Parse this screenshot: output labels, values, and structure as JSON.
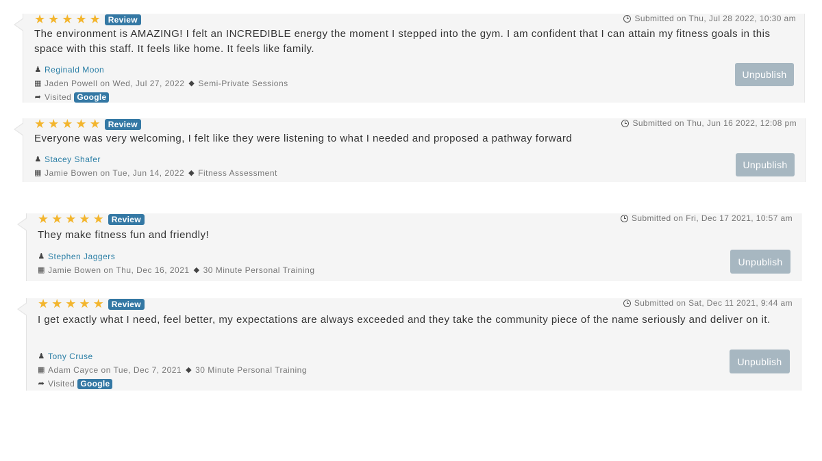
{
  "reviews": [
    {
      "stars": [
        "★",
        "★",
        "★",
        "★",
        "★"
      ],
      "badge": "Review",
      "submitted": "Submitted on Thu, Jul 28 2022, 10:30 am",
      "text": "The environment is AMAZING! I felt an INCREDIBLE energy the moment I stepped into the gym. I am confident that I can attain my fitness goals in this space with this staff. It feels like home. It feels like family.",
      "author": "Reginald Moon",
      "booking": "Jaden Powell on Wed, Jul 27, 2022",
      "service": "Semi-Private Sessions",
      "visited_label": "Visited",
      "visited_source": "Google",
      "button": "Unpublish"
    },
    {
      "stars": [
        "★",
        "★",
        "★",
        "★",
        "★"
      ],
      "badge": "Review",
      "submitted": "Submitted on Thu, Jun 16 2022, 12:08 pm",
      "text": "Everyone was very welcoming, I felt like they were listening to what I needed and proposed a pathway forward",
      "author": "Stacey Shafer",
      "booking": "Jamie Bowen on Tue, Jun 14, 2022",
      "service": "Fitness Assessment",
      "button": "Unpublish"
    },
    {
      "stars": [
        "★",
        "★",
        "★",
        "★",
        "★"
      ],
      "badge": "Review",
      "submitted": "Submitted on Fri, Dec 17 2021, 10:57 am",
      "text": "They make fitness fun and friendly!",
      "author": "Stephen Jaggers",
      "booking": "Jamie Bowen on Thu, Dec 16, 2021",
      "service": "30 Minute Personal Training",
      "button": "Unpublish"
    },
    {
      "stars": [
        "★",
        "★",
        "★",
        "★",
        "★"
      ],
      "badge": "Review",
      "submitted": "Submitted on Sat, Dec 11 2021, 9:44 am",
      "text": "I get exactly what I need, feel better, my expectations are always exceeded and they take the community piece of the name seriously and deliver on it.",
      "author": "Tony Cruse",
      "booking": "Adam Cayce on Tue, Dec 7, 2021",
      "service": "30 Minute Personal Training",
      "visited_label": "Visited",
      "visited_source": "Google",
      "button": "Unpublish"
    }
  ]
}
